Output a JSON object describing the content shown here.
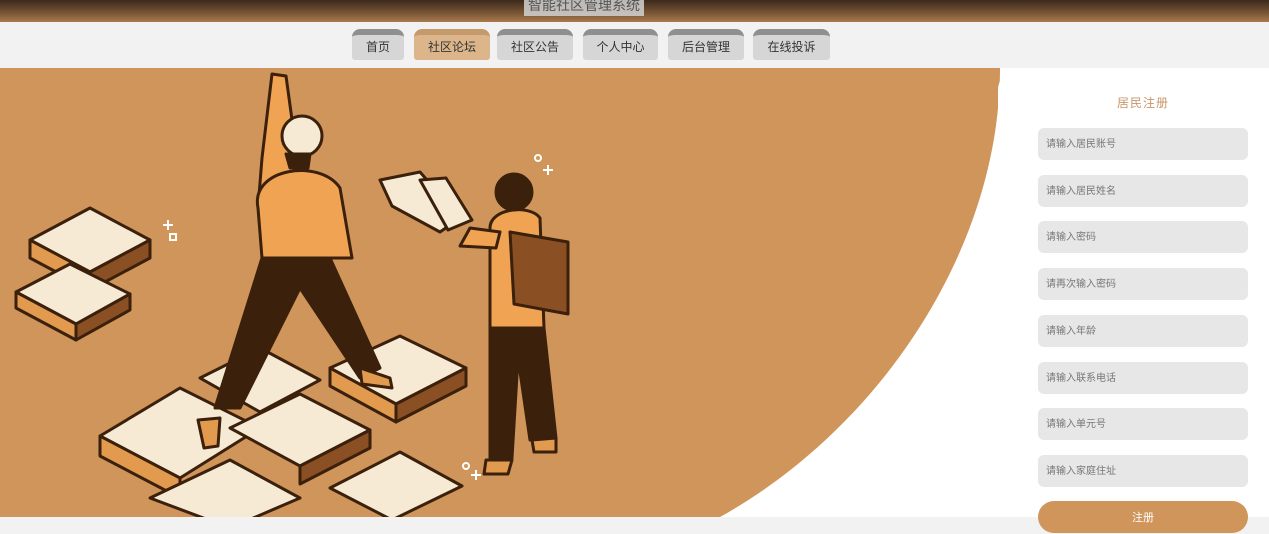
{
  "app": {
    "title": "智能社区管理系统"
  },
  "nav": {
    "items": [
      {
        "label": "首页",
        "active": false
      },
      {
        "label": "社区论坛",
        "active": true
      },
      {
        "label": "社区公告",
        "active": false
      },
      {
        "label": "个人中心",
        "active": false
      },
      {
        "label": "后台管理",
        "active": false
      },
      {
        "label": "在线投诉",
        "active": false
      }
    ]
  },
  "register": {
    "title": "居民注册",
    "fields": [
      {
        "placeholder": "请输入居民账号",
        "value": ""
      },
      {
        "placeholder": "请输入居民姓名",
        "value": ""
      },
      {
        "placeholder": "请输入密码",
        "value": ""
      },
      {
        "placeholder": "请再次输入密码",
        "value": ""
      },
      {
        "placeholder": "请输入年龄",
        "value": ""
      },
      {
        "placeholder": "请输入联系电话",
        "value": ""
      },
      {
        "placeholder": "请输入单元号",
        "value": ""
      },
      {
        "placeholder": "请输入家庭住址",
        "value": ""
      }
    ],
    "submit_label": "注册"
  },
  "colors": {
    "accent": "#cf955a",
    "dark": "#4a2a12",
    "cream": "#f6ead4",
    "orange": "#f0a353"
  }
}
